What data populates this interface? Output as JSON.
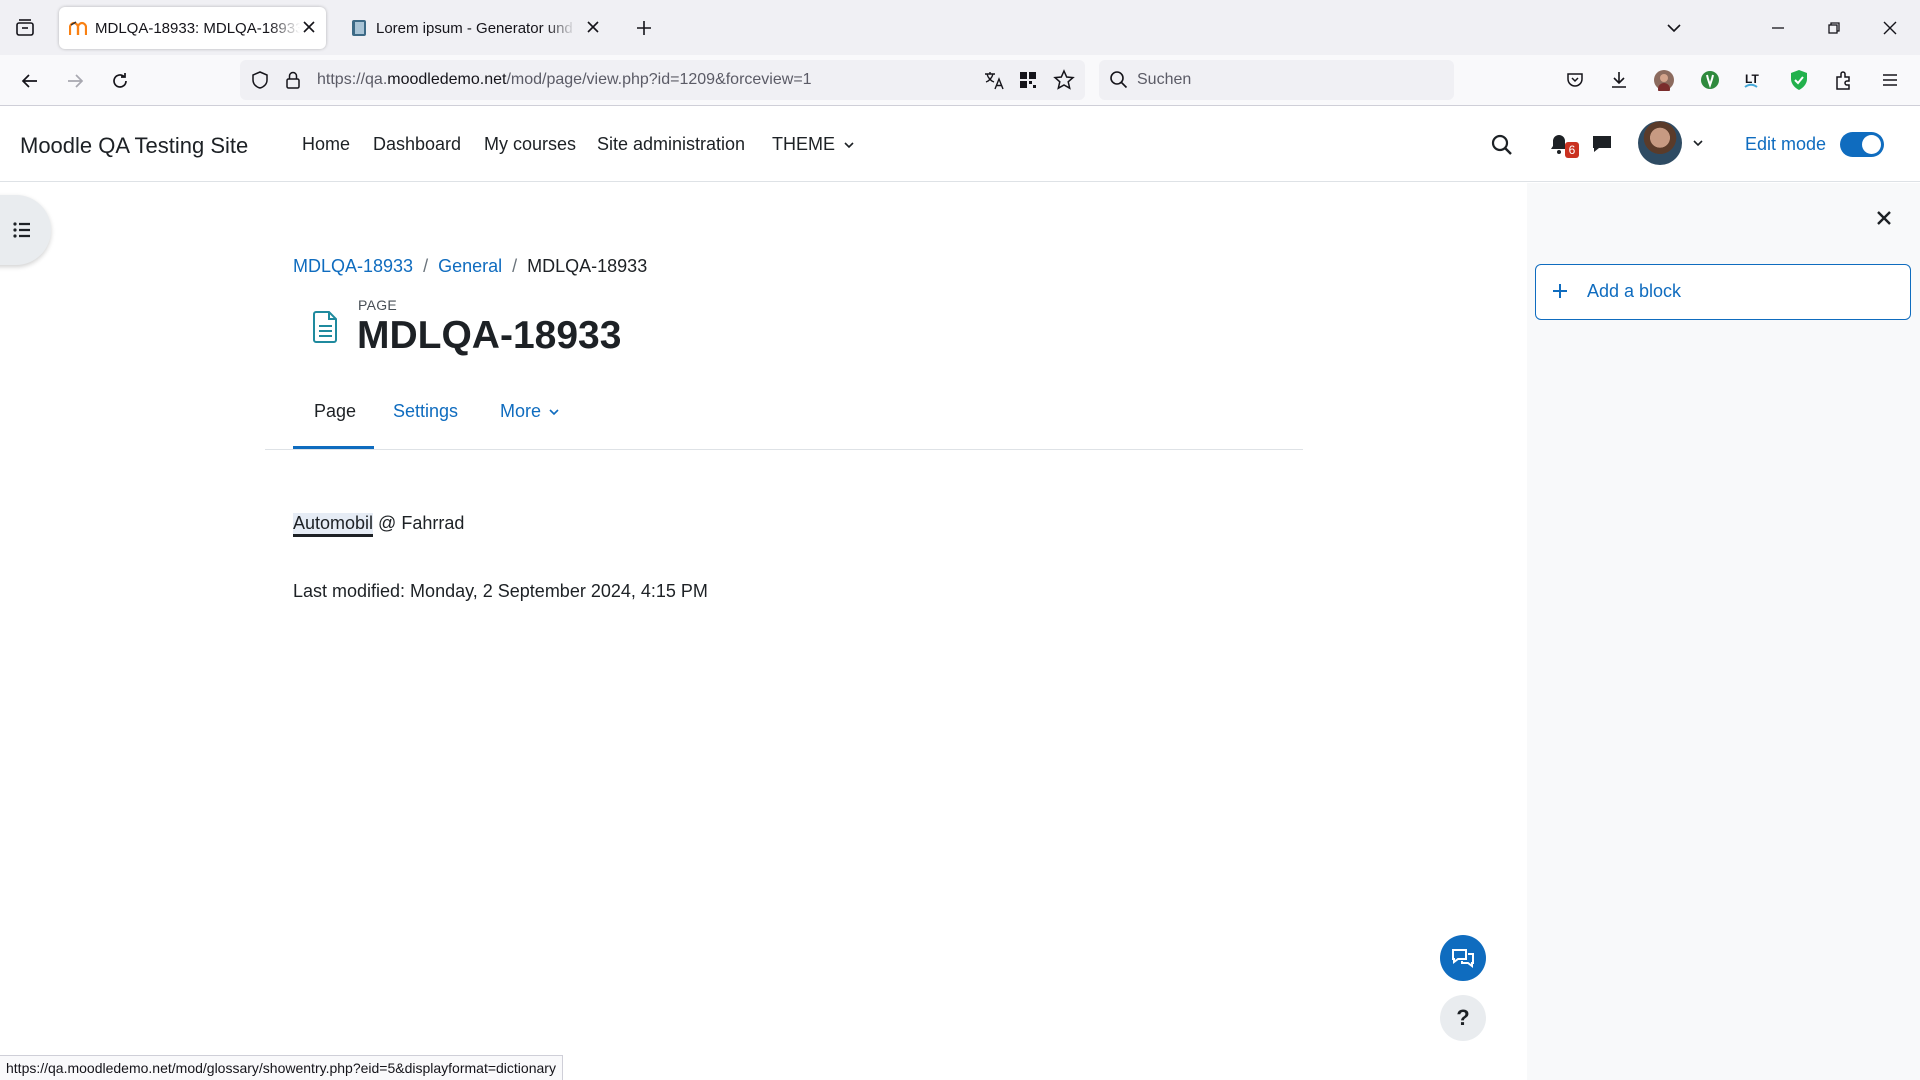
{
  "browser": {
    "tabs": [
      {
        "title": "MDLQA-18933: MDLQA-18933",
        "active": true,
        "favicon": "moodle-favicon"
      },
      {
        "title": "Lorem ipsum - Generator und Info",
        "active": false,
        "favicon": "book-favicon"
      }
    ],
    "url_prefix": "https://qa.",
    "url_domain": "moodledemo.net",
    "url_path": "/mod/page/view.php?id=1209&forceview=1",
    "search_placeholder": "Suchen",
    "status_url": "https://qa.moodledemo.net/mod/glossary/showentry.php?eid=5&displayformat=dictionary"
  },
  "moodle": {
    "site_name": "Moodle QA Testing Site",
    "primary_nav": [
      "Home",
      "Dashboard",
      "My courses",
      "Site administration",
      "THEME"
    ],
    "notification_count": "6",
    "edit_mode_label": "Edit mode",
    "edit_mode_on": true,
    "breadcrumb": [
      "MDLQA-18933",
      "General",
      "MDLQA-18933"
    ],
    "page_kicker": "PAGE",
    "page_title": "MDLQA-18933",
    "secondary_nav": {
      "page": "Page",
      "settings": "Settings",
      "more": "More"
    },
    "content": {
      "glossary_term": "Automobil",
      "rest": " @ Fahrrad"
    },
    "last_modified": "Last modified: Monday, 2 September 2024, 4:15 PM",
    "add_block_label": "Add a block",
    "help_symbol": "?",
    "accent_color": "#0f6cbf"
  }
}
